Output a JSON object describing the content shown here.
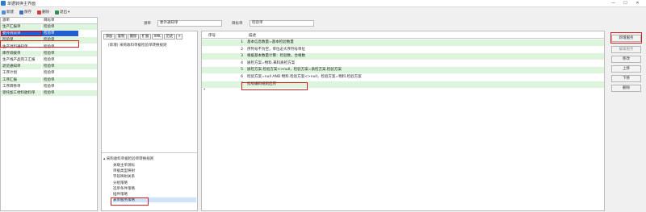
{
  "window": {
    "title": "单据转换主界面",
    "controls": [
      "—",
      "☐",
      "✕"
    ]
  },
  "toolbar": [
    {
      "label": "新建",
      "icon": "new-document-icon",
      "color": "#4a90d9"
    },
    {
      "label": "保存",
      "icon": "save-icon",
      "color": "#3b6fc2"
    },
    {
      "label": "删除",
      "icon": "delete-icon",
      "color": "#d43b3b"
    },
    {
      "label": "退出",
      "icon": "exit-icon",
      "color": "#2f8f4f"
    }
  ],
  "left_grid": {
    "headers": [
      "源单",
      "目标单"
    ],
    "rows": [
      [
        "生产汇报单",
        "检验单"
      ],
      [
        "委外到货单",
        "检验单"
      ],
      [
        "检验单",
        "检验单"
      ],
      [
        "生产退料通知单",
        "检验单"
      ],
      [
        "库存调拨单",
        "检验单"
      ],
      [
        "生产线产品完工汇报",
        "检验单"
      ],
      [
        "退货通知单",
        "检验单"
      ],
      [
        "工序计划",
        "检验单"
      ],
      [
        "工序汇报",
        "检验单"
      ],
      [
        "工序转移单",
        "检验单"
      ],
      [
        "受托加工材料收料单",
        "检验单"
      ]
    ],
    "selected_row": 1
  },
  "form": {
    "source_label": "源单",
    "source_value": "委外通知单",
    "target_label": "目标单",
    "target_value": "检验单"
  },
  "mid_toolbar": [
    "添加",
    "复制",
    "删除",
    "扩展",
    "XML",
    "历史",
    "+"
  ],
  "mid_tree_top": "(新增) 采购收料单据检验单转换规则",
  "mid_tree_bottom": {
    "root": "采购收料单据检验单转换规则",
    "children": [
      "关联主单源标",
      "单据类型映射",
      "字段映射关系",
      "分组策略",
      "选单条件策略",
      "插件策略",
      "表单服务策略"
    ],
    "selected_child": 6
  },
  "right_grid": {
    "headers": [
      "序号",
      "描述"
    ],
    "rows": [
      {
        "num": "1",
        "desc": "基本信息数量=基本检验数量"
      },
      {
        "num": "2",
        "desc": "序列号不为空，单位必大序列号单位"
      },
      {
        "num": "3",
        "desc": "根据基本数量计算：检验数，合格数"
      },
      {
        "num": "4",
        "desc": "质检方案=物料.来料质检方案"
      },
      {
        "num": "5",
        "desc": "质检方案.检验方案<>null，检验方案=质检方案.检验方案"
      },
      {
        "num": "6",
        "desc": "检验方案=null AND 物料.检验方案<>null，检验方案=物料.检验方案"
      },
      {
        "num": "7",
        "desc": "批号编码规则应用"
      }
    ],
    "new_row_marker": "*"
  },
  "right_buttons": [
    "新增服务",
    "编辑服务",
    "移改",
    "上移",
    "下移",
    "删除"
  ]
}
